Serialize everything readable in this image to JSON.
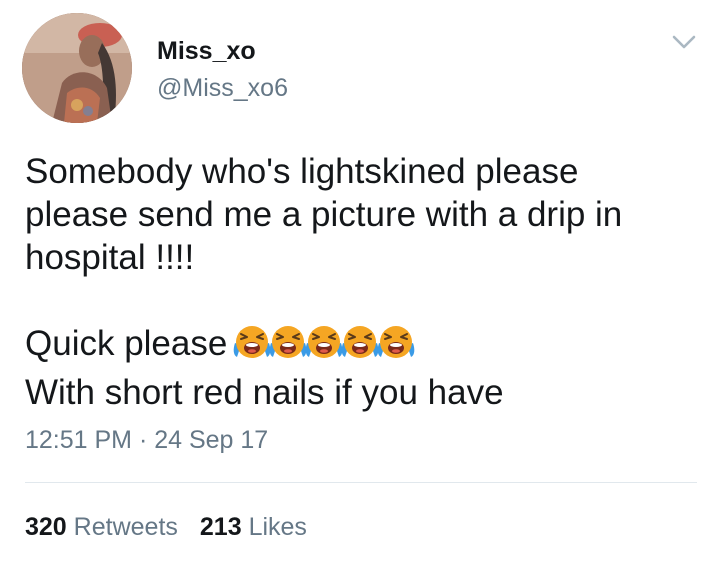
{
  "user": {
    "display_name": "Miss_xo",
    "handle": "@Miss_xo6"
  },
  "tweet": {
    "line1": "Somebody who's lightskined please",
    "line2": "please send me a picture with a drip in",
    "line3": "hospital !!!!",
    "line4_text": "Quick please",
    "line4_emoji_count": 5,
    "line5": "With short red nails if you have"
  },
  "timestamp": "12:51 PM · 24 Sep 17",
  "stats": {
    "retweets_count": "320",
    "retweets_label": "Retweets",
    "likes_count": "213",
    "likes_label": "Likes"
  },
  "icons": {
    "menu": "chevron-down-icon",
    "emoji": "loudly-crying-face-icon"
  },
  "colors": {
    "text_primary": "#14171a",
    "text_secondary": "#657786",
    "divider": "#e1e8ed",
    "emoji_face": "#f5a623",
    "emoji_tears": "#3b9be6"
  }
}
